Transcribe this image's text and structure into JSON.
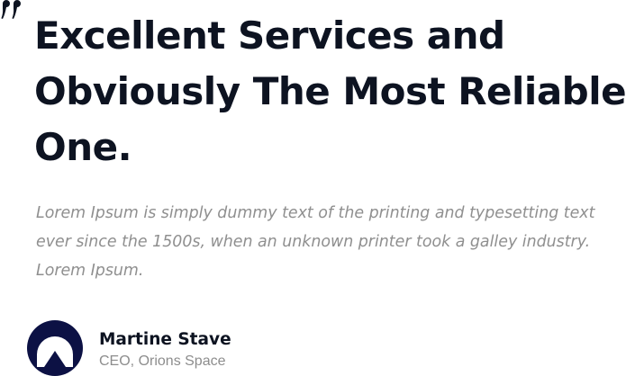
{
  "testimonial": {
    "quote_icon": "quote-icon",
    "headline": "Excellent Services and Obviously The Most Reliable One.",
    "body": "Lorem Ipsum is simply dummy text of the printing and typesetting text ever since the 1500s, when an unknown printer took a galley industry. Lorem Ipsum.",
    "author": {
      "avatar_icon": "company-logo",
      "name": "Martine Stave",
      "role": "CEO, Orions Space"
    }
  },
  "colors": {
    "heading": "#0d1321",
    "body_text": "#8f8f8f",
    "logo_background": "#0c1144",
    "logo_mark": "#ffffff"
  }
}
